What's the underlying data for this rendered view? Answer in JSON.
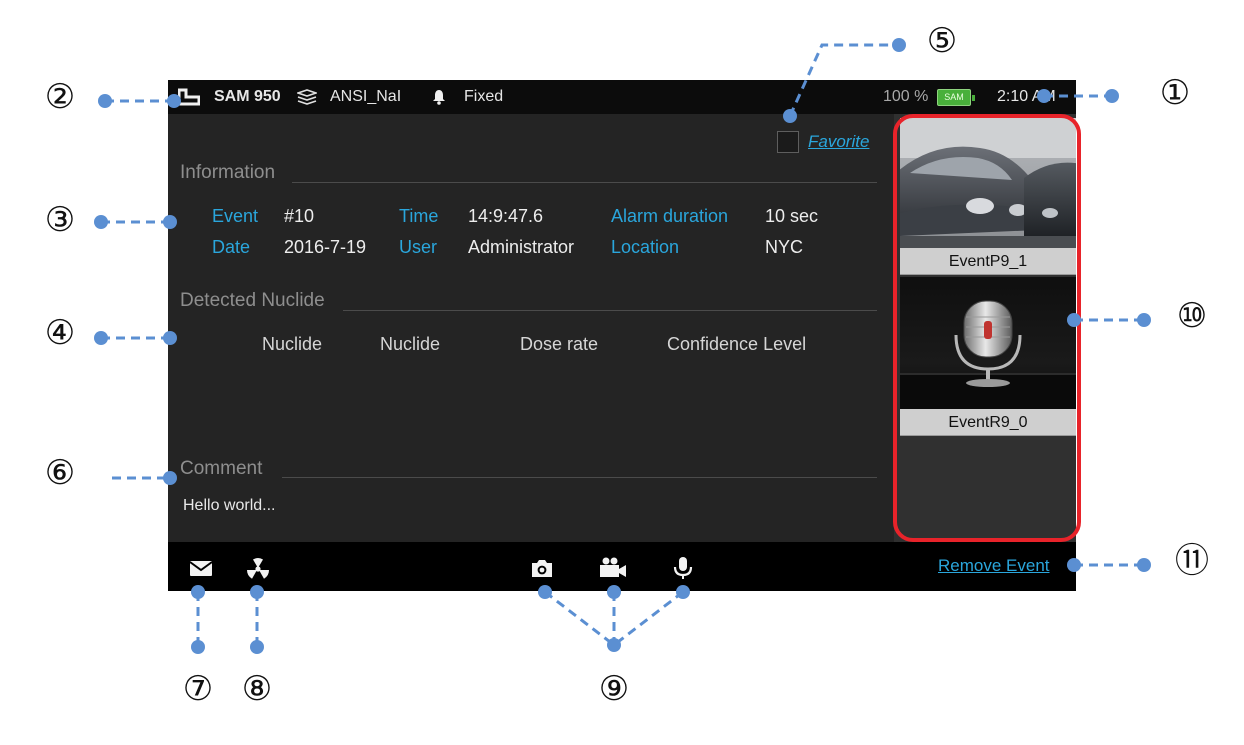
{
  "status_bar": {
    "device_model": "SAM 950",
    "library": "ANSI_NaI",
    "mode": "Fixed",
    "battery_percent": "100 %",
    "battery_badge": "SAM",
    "time": "2:10 AM"
  },
  "favorite": {
    "label": "Favorite",
    "checked": false
  },
  "information": {
    "title": "Information",
    "fields": [
      {
        "label": "Event",
        "value": "#10"
      },
      {
        "label": "Time",
        "value": "14:9:47.6"
      },
      {
        "label": "Alarm duration",
        "value": "10 sec"
      },
      {
        "label": "Date",
        "value": "2016-7-19"
      },
      {
        "label": "User",
        "value": "Administrator"
      },
      {
        "label": "Location",
        "value": "NYC"
      }
    ]
  },
  "detected_nuclide": {
    "title": "Detected Nuclide",
    "columns": [
      "Nuclide",
      "Nuclide",
      "Dose rate",
      "Confidence Level"
    ],
    "rows": []
  },
  "comment": {
    "title": "Comment",
    "text": "Hello world..."
  },
  "media": [
    {
      "type": "photo",
      "caption": "EventP9_1"
    },
    {
      "type": "audio",
      "caption": "EventR9_0"
    }
  ],
  "bottom_bar": {
    "icons": [
      "mail-icon",
      "radiation-icon",
      "camera-icon",
      "video-camera-icon",
      "microphone-icon"
    ],
    "remove_label": "Remove Event"
  },
  "callouts": [
    "①",
    "②",
    "③",
    "④",
    "⑤",
    "⑥",
    "⑦",
    "⑧",
    "⑨",
    "⑩",
    "⑪"
  ],
  "colors": {
    "accent": "#2aa6dc",
    "highlight": "#e8232a",
    "callout_dot": "#5b8fd2",
    "screen_bg": "#242424",
    "battery": "#49b03b"
  }
}
